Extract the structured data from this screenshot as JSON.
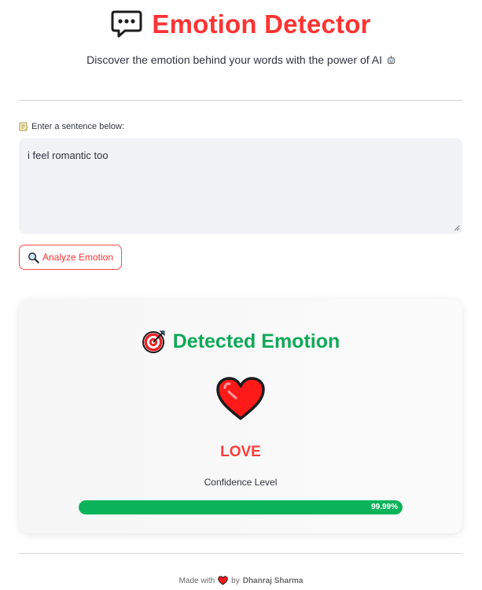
{
  "header": {
    "title": "Emotion Detector",
    "subtitle": "Discover the emotion behind your words with the power of AI",
    "title_color": "#ff3333",
    "icon": "speech-bubble-icon",
    "subtitle_icon": "robot-icon"
  },
  "input": {
    "label": "Enter a sentence below:",
    "label_icon": "memo-icon",
    "value": "i feel romantic too"
  },
  "analyze_button": {
    "label": "Analyze Emotion",
    "icon": "magnifier-icon",
    "accent": "#ff4b4b"
  },
  "result": {
    "title": "Detected Emotion",
    "title_icon": "target-icon",
    "title_color": "#0fa958",
    "emotion_icon": "heart-icon",
    "emotion": "LOVE",
    "emotion_color": "#ff3b3b",
    "confidence_label": "Confidence Level",
    "confidence_text": "99.99%",
    "confidence_value": 0.9999,
    "bar_color": "#0db35a"
  },
  "footer": {
    "made_with": "Made with",
    "by": "by",
    "author": "Dhanraj Sharma",
    "heart_icon": "heart-icon"
  }
}
